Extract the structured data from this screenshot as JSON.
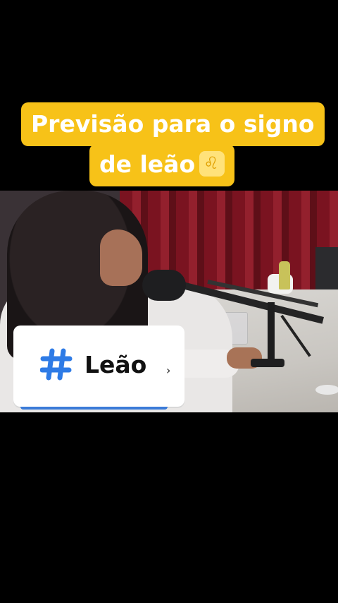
{
  "caption": {
    "line1": "Previsão para o signo",
    "line2": "de leão",
    "emoji_icon": "leo-zodiac-icon",
    "emoji_char": "♌",
    "background_color": "#f7c218",
    "text_color": "#ffffff"
  },
  "hashtag": {
    "icon": "hashtag-icon",
    "icon_color": "#2e7be6",
    "label": "Leão",
    "trailing_mark": "›"
  }
}
